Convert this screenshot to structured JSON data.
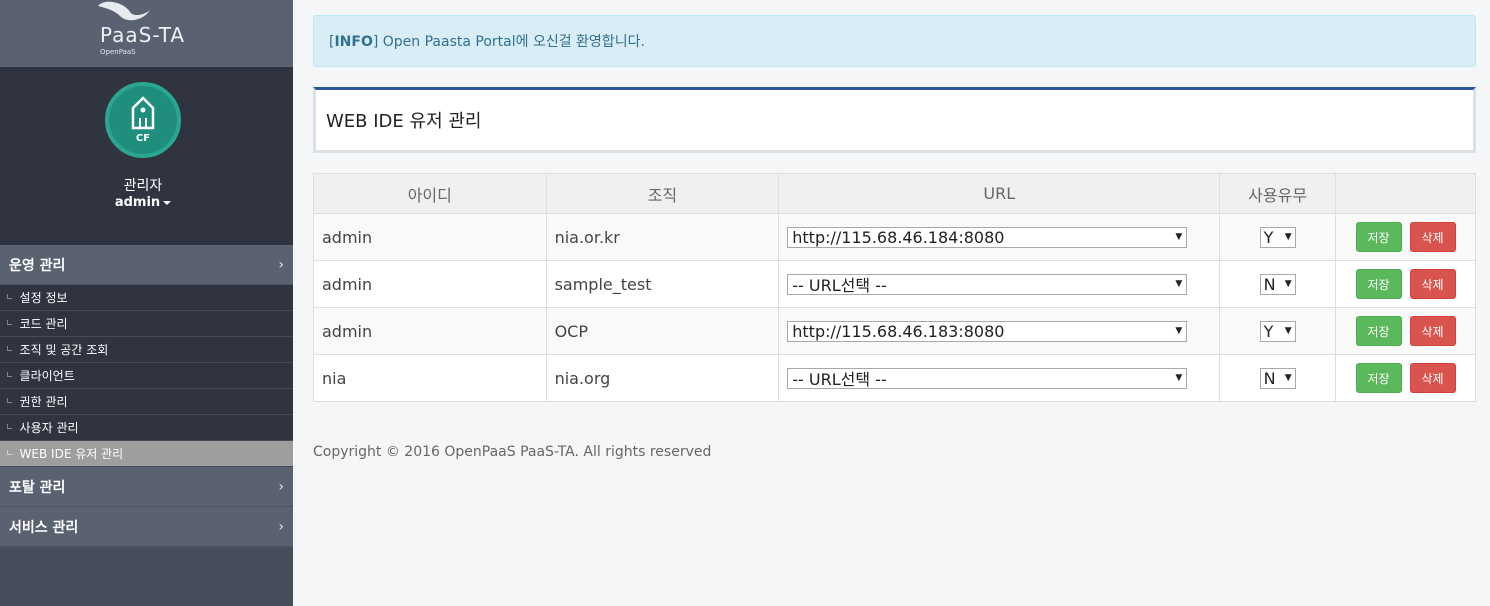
{
  "brand": {
    "name": "PaaS-TA",
    "sub": "OpenPaaS"
  },
  "profile": {
    "badge": "CF",
    "role": "관리자",
    "username": "admin"
  },
  "menu": [
    {
      "label": "운영 관리",
      "items": [
        "설정 정보",
        "코드 관리",
        "조직 및 공간 조회",
        "클라이언트",
        "권한 관리",
        "사용자 관리",
        "WEB IDE 유저 관리"
      ],
      "active": "WEB IDE 유저 관리"
    },
    {
      "label": "포탈 관리"
    },
    {
      "label": "서비스 관리"
    }
  ],
  "alert": {
    "tag": "INFO",
    "message": " Open Paasta Portal에 오신걸 환영합니다."
  },
  "page": {
    "title": "WEB IDE 유저 관리"
  },
  "table": {
    "headers": [
      "아이디",
      "조직",
      "URL",
      "사용유무",
      ""
    ],
    "rows": [
      {
        "id": "admin",
        "org": "nia.or.kr",
        "url": "http://115.68.46.184:8080",
        "use": "Y"
      },
      {
        "id": "admin",
        "org": "sample_test",
        "url": "-- URL선택 --",
        "use": "N"
      },
      {
        "id": "admin",
        "org": "OCP",
        "url": "http://115.68.46.183:8080",
        "use": "Y"
      },
      {
        "id": "nia",
        "org": "nia.org",
        "url": "-- URL선택 --",
        "use": "N"
      }
    ],
    "save_label": "저장",
    "delete_label": "삭제"
  },
  "footer": {
    "copyright": "Copyright © 2016 OpenPaaS PaaS-TA. All rights reserved"
  },
  "colors": {
    "save": "#5cb85c",
    "delete": "#d9534f",
    "accent": "#2a57a2",
    "avatar": "#1f8e7c"
  }
}
